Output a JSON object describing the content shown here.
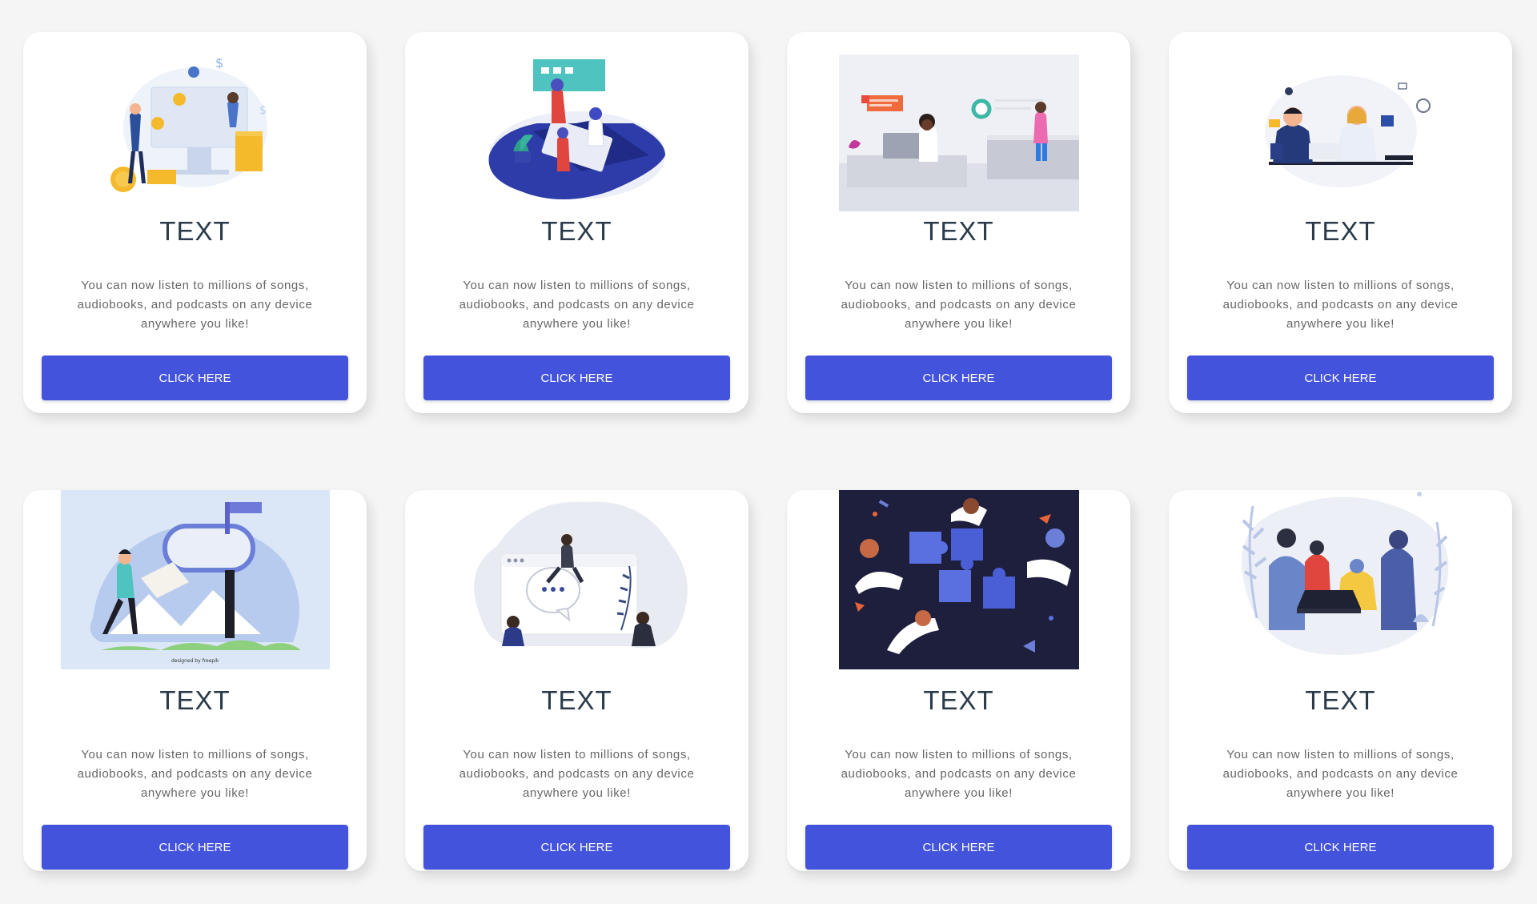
{
  "cards": [
    {
      "image": "illustration-payments-icon",
      "title": "TEXT",
      "text": "You can now listen to millions of songs, audiobooks, and podcasts on any device anywhere you like!",
      "button": "CLICK HERE"
    },
    {
      "image": "illustration-teamwork-icon",
      "title": "TEXT",
      "text": "You can now listen to millions of songs, audiobooks, and podcasts on any device anywhere you like!",
      "button": "CLICK HERE"
    },
    {
      "image": "illustration-office-icon",
      "title": "TEXT",
      "text": "You can now listen to millions of songs, audiobooks, and podcasts on any device anywhere you like!",
      "button": "CLICK HERE"
    },
    {
      "image": "illustration-support-icon",
      "title": "TEXT",
      "text": "You can now listen to millions of songs, audiobooks, and podcasts on any device anywhere you like!",
      "button": "CLICK HERE"
    },
    {
      "image": "illustration-mailbox-icon",
      "title": "TEXT",
      "text": "You can now listen to millions of songs, audiobooks, and podcasts on any device anywhere you like!",
      "button": "CLICK HERE",
      "credit": "designed by freepik"
    },
    {
      "image": "illustration-chat-icon",
      "title": "TEXT",
      "text": "You can now listen to millions of songs, audiobooks, and podcasts on any device anywhere you like!",
      "button": "CLICK HERE"
    },
    {
      "image": "illustration-puzzle-icon",
      "title": "TEXT",
      "text": "You can now listen to millions of songs, audiobooks, and podcasts on any device anywhere you like!",
      "button": "CLICK HERE"
    },
    {
      "image": "illustration-meeting-icon",
      "title": "TEXT",
      "text": "You can now listen to millions of songs, audiobooks, and podcasts on any device anywhere you like!",
      "button": "CLICK HERE"
    }
  ],
  "colors": {
    "button": "#4353dc",
    "title": "#2a3a4a",
    "background": "#f5f5f6",
    "card": "#ffffff"
  }
}
